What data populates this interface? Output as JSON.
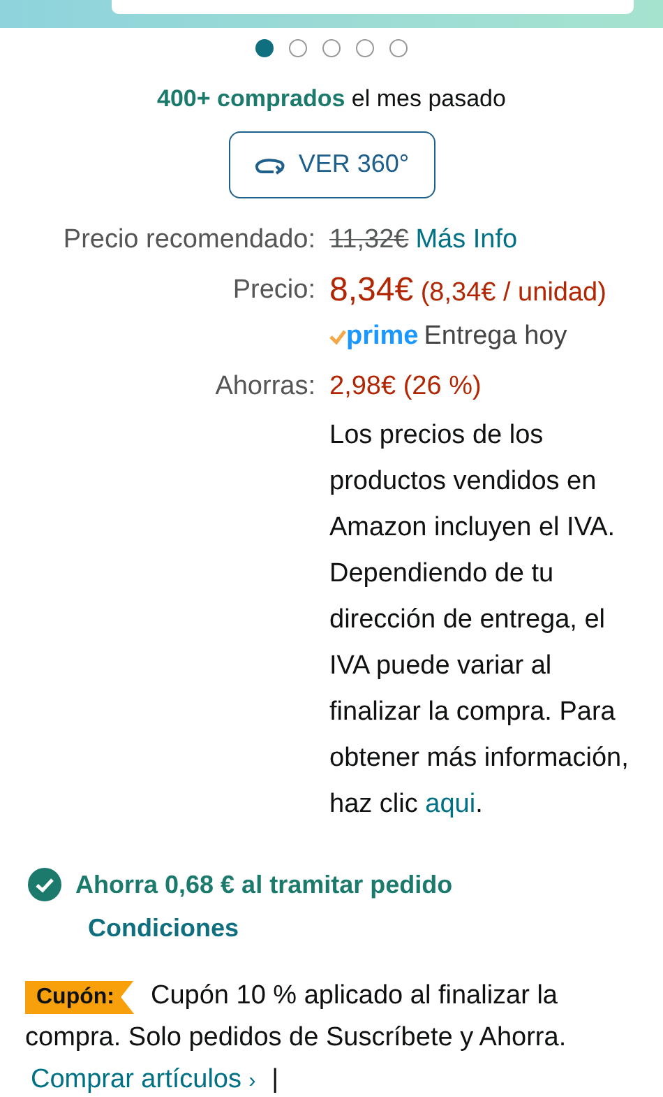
{
  "carousel": {
    "dots": [
      {
        "selected": true
      },
      {
        "selected": false
      },
      {
        "selected": false
      },
      {
        "selected": false
      },
      {
        "selected": false
      }
    ]
  },
  "purchases": "**400+ comprados** el mes pasado",
  "view_360_button": {
    "label": "VER 360°"
  },
  "prices": {
    "list_price": {
      "label": "Precio recomendado:",
      "value": "11,32€",
      "link": "Más Info"
    },
    "price": {
      "label": "Precio:",
      "value": "8,34€",
      "unit": "(8,34€ / unidad)",
      "prime": "prime",
      "delivery": "Entrega hoy"
    },
    "savings": {
      "label": "Ahorras:",
      "value": "2,98€ (26 %)"
    },
    "tax_note": {
      "text": "Los precios de los productos vendidos en Amazon incluyen el IVA. Dependiendo de tu dirección de entrega, el IVA puede variar al finalizar la compra. Para obtener más información, haz clic",
      "link": "aqui",
      "end": "."
    }
  },
  "checkout_saving": {
    "text": "Ahorra 0,68 € al tramitar pedido",
    "link": "Condiciones"
  },
  "coupon": {
    "badge": "Cupón:",
    "text": "Cupón 10 % aplicado al finalizar la compra. Solo pedidos de Suscríbete y Ahorra.",
    "link": "Comprar artículos",
    "chevron": "›",
    "separator": "|"
  }
}
